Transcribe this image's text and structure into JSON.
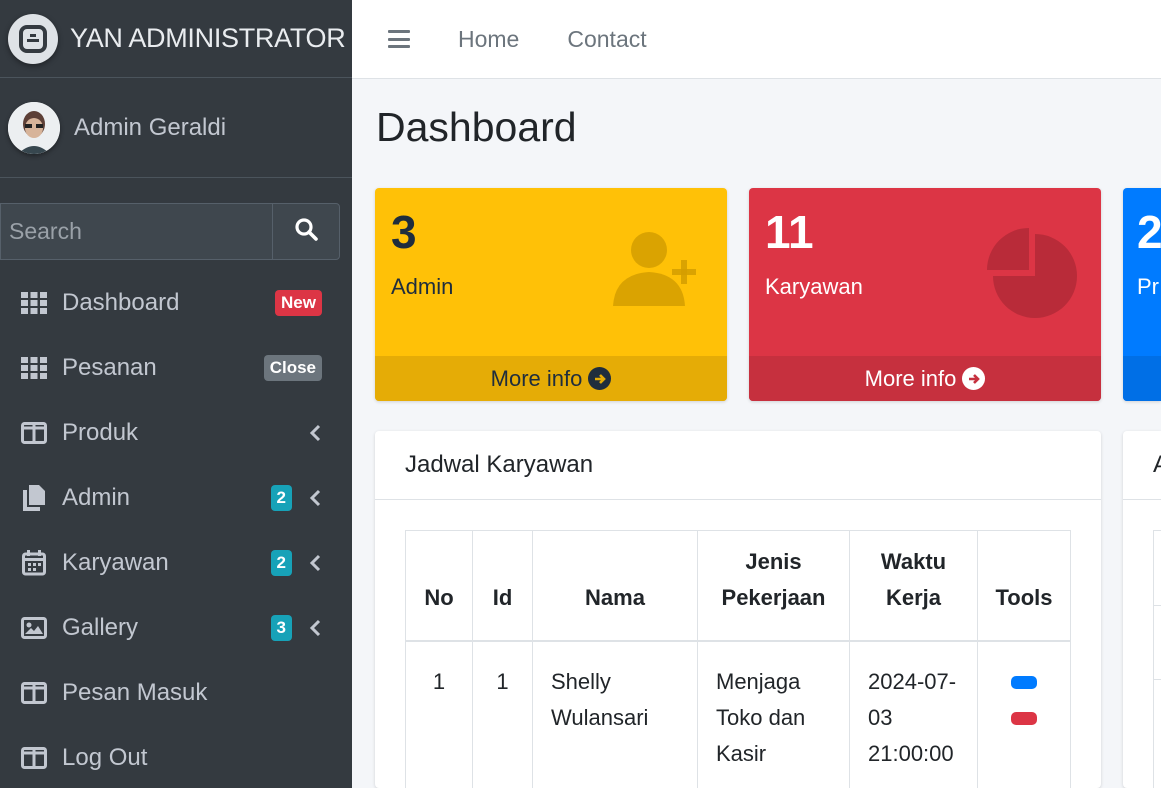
{
  "brand": {
    "title": "YAN ADMINISTRATOR",
    "logo_icon": "admin-logo-icon"
  },
  "user": {
    "name": "Admin Geraldi"
  },
  "search": {
    "placeholder": "Search"
  },
  "sidebar": {
    "items": [
      {
        "label": "Dashboard",
        "icon": "grid-icon",
        "badge": "New",
        "badge_color": "#dc3545"
      },
      {
        "label": "Pesanan",
        "icon": "grid-icon",
        "badge": "Close",
        "badge_color": "#6c757d"
      },
      {
        "label": "Produk",
        "icon": "columns-icon",
        "chevron": true
      },
      {
        "label": "Admin",
        "icon": "copy-icon",
        "badge": "2",
        "badge_color": "#17a2b8",
        "chevron": true
      },
      {
        "label": "Karyawan",
        "icon": "calendar-icon",
        "badge": "2",
        "badge_color": "#17a2b8",
        "chevron": true
      },
      {
        "label": "Gallery",
        "icon": "image-icon",
        "badge": "3",
        "badge_color": "#17a2b8",
        "chevron": true
      },
      {
        "label": "Pesan Masuk",
        "icon": "columns-icon"
      },
      {
        "label": "Log Out",
        "icon": "columns-icon"
      }
    ]
  },
  "header": {
    "links": [
      "Home",
      "Contact"
    ]
  },
  "page": {
    "title": "Dashboard"
  },
  "boxes": [
    {
      "number": "3",
      "label": "Admin",
      "footer": "More info",
      "color": "#ffc107",
      "footer_color": "#e5ac06"
    },
    {
      "number": "11",
      "label": "Karyawan",
      "footer": "More info",
      "color": "#dc3545",
      "footer_color": "#c6303e"
    },
    {
      "number": "2",
      "label": "Pr",
      "color": "#007bff"
    }
  ],
  "schedule": {
    "title": "Jadwal Karyawan",
    "columns": [
      "No",
      "Id",
      "Nama",
      "Jenis Pekerjaan",
      "Waktu Kerja",
      "Tools"
    ],
    "rows": [
      {
        "no": "1",
        "id": "1",
        "nama": "Shelly Wulansari",
        "jenis": "Menjaga Toko dan Kasir",
        "waktu": "2024-07-03 21:00:00"
      }
    ]
  },
  "side_card": {
    "title": "A"
  },
  "colors": {
    "primary": "#007bff",
    "danger": "#dc3545",
    "warning": "#ffc107",
    "sidebar": "#343a40"
  }
}
